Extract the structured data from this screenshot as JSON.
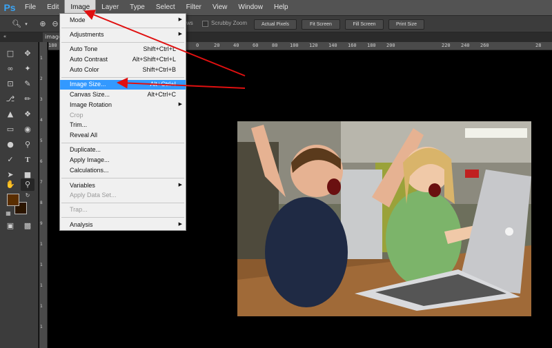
{
  "app": {
    "logo": "Ps",
    "menus": [
      "File",
      "Edit",
      "Image",
      "Layer",
      "Type",
      "Select",
      "Filter",
      "View",
      "Window",
      "Help"
    ]
  },
  "options_bar": {
    "partial_label": "ws",
    "scrubby_zoom": "Scrubby Zoom",
    "actual_pixels": "Actual Pixels",
    "fit_screen": "Fit Screen",
    "fill_screen": "Fill Screen",
    "print_size": "Print Size"
  },
  "doc_tab": {
    "label": "image"
  },
  "ruler": {
    "h_ticks": [
      "180",
      "0",
      "20",
      "40",
      "60",
      "80",
      "100",
      "120",
      "140",
      "160",
      "180",
      "200",
      "220",
      "240",
      "260",
      "28"
    ],
    "v_ticks": [
      "1",
      "2",
      "3",
      "4",
      "5",
      "6",
      "7",
      "8",
      "9",
      "1",
      "1",
      "1",
      "1",
      "1"
    ]
  },
  "image_menu": {
    "items": [
      {
        "label": "Mode",
        "shortcut": "",
        "submenu": true,
        "disabled": false
      },
      {
        "label": "Adjustments",
        "shortcut": "",
        "submenu": true,
        "disabled": false
      },
      {
        "label": "Auto Tone",
        "shortcut": "Shift+Ctrl+L",
        "submenu": false,
        "disabled": false
      },
      {
        "label": "Auto Contrast",
        "shortcut": "Alt+Shift+Ctrl+L",
        "submenu": false,
        "disabled": false
      },
      {
        "label": "Auto Color",
        "shortcut": "Shift+Ctrl+B",
        "submenu": false,
        "disabled": false
      },
      {
        "label": "Image Size...",
        "shortcut": "Alt+Ctrl+I",
        "submenu": false,
        "disabled": false,
        "highlighted": true
      },
      {
        "label": "Canvas Size...",
        "shortcut": "Alt+Ctrl+C",
        "submenu": false,
        "disabled": false
      },
      {
        "label": "Image Rotation",
        "shortcut": "",
        "submenu": true,
        "disabled": false
      },
      {
        "label": "Crop",
        "shortcut": "",
        "submenu": false,
        "disabled": true
      },
      {
        "label": "Trim...",
        "shortcut": "",
        "submenu": false,
        "disabled": false
      },
      {
        "label": "Reveal All",
        "shortcut": "",
        "submenu": false,
        "disabled": false
      },
      {
        "label": "Duplicate...",
        "shortcut": "",
        "submenu": false,
        "disabled": false
      },
      {
        "label": "Apply Image...",
        "shortcut": "",
        "submenu": false,
        "disabled": false
      },
      {
        "label": "Calculations...",
        "shortcut": "",
        "submenu": false,
        "disabled": false
      },
      {
        "label": "Variables",
        "shortcut": "",
        "submenu": true,
        "disabled": false
      },
      {
        "label": "Apply Data Set...",
        "shortcut": "",
        "submenu": false,
        "disabled": true
      },
      {
        "label": "Trap...",
        "shortcut": "",
        "submenu": false,
        "disabled": true
      },
      {
        "label": "Analysis",
        "shortcut": "",
        "submenu": true,
        "disabled": false
      }
    ]
  },
  "colors": {
    "foreground": "#5a2e00",
    "background": "#2b1500",
    "highlight": "#3399ff",
    "annotation": "#e01010",
    "logo": "#3aa4f5"
  }
}
